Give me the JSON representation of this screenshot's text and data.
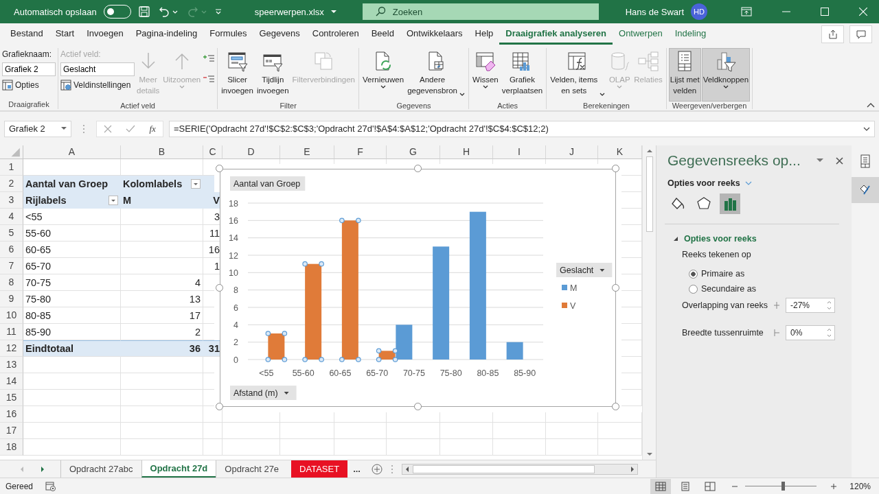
{
  "title_bar": {
    "autosave_label": "Automatisch opslaan",
    "autosave_on": false,
    "file_name": "speerwerpen.xlsx",
    "search_placeholder": "Zoeken",
    "user_name": "Hans de Swart",
    "user_initials": "HD"
  },
  "menu_tabs": [
    {
      "label": "Bestand",
      "selected": false,
      "kind": "normal"
    },
    {
      "label": "Start",
      "selected": false,
      "kind": "normal"
    },
    {
      "label": "Invoegen",
      "selected": false,
      "kind": "normal"
    },
    {
      "label": "Pagina-indeling",
      "selected": false,
      "kind": "normal"
    },
    {
      "label": "Formules",
      "selected": false,
      "kind": "normal"
    },
    {
      "label": "Gegevens",
      "selected": false,
      "kind": "normal"
    },
    {
      "label": "Controleren",
      "selected": false,
      "kind": "normal"
    },
    {
      "label": "Beeld",
      "selected": false,
      "kind": "normal"
    },
    {
      "label": "Ontwikkelaars",
      "selected": false,
      "kind": "normal"
    },
    {
      "label": "Help",
      "selected": false,
      "kind": "normal"
    },
    {
      "label": "Draaigrafiek analyseren",
      "selected": true,
      "kind": "contextual"
    },
    {
      "label": "Ontwerpen",
      "selected": false,
      "kind": "contextual"
    },
    {
      "label": "Indeling",
      "selected": false,
      "kind": "contextual"
    }
  ],
  "ribbon": {
    "groups": [
      {
        "label": "Draaigrafiek",
        "items": [
          {
            "kind": "caption",
            "text": "Grafieknaam:",
            "disabled": false
          },
          {
            "kind": "field",
            "value": "Grafiek 2"
          },
          {
            "kind": "small",
            "label": "Opties",
            "disabled": false
          }
        ]
      },
      {
        "label": "Actief veld",
        "items": [
          {
            "kind": "caption",
            "text": "Actief veld:",
            "disabled": true
          },
          {
            "kind": "field",
            "value": "Geslacht"
          },
          {
            "kind": "small",
            "label": "Veldinstellingen",
            "disabled": false
          },
          {
            "kind": "big",
            "label": "Meer\ndetails",
            "disabled": true,
            "dropdown": false,
            "pressed": false
          },
          {
            "kind": "big",
            "label": "Uitzoomen",
            "disabled": true,
            "dropdown": true,
            "pressed": false
          },
          {
            "kind": "expand",
            "disabled": false
          },
          {
            "kind": "collapse",
            "disabled": false
          }
        ]
      },
      {
        "label": "Filter",
        "items": [
          {
            "kind": "big",
            "label": "Slicer\ninvoegen",
            "disabled": false,
            "dropdown": false,
            "pressed": false
          },
          {
            "kind": "big",
            "label": "Tijdlijn\ninvoegen",
            "disabled": false,
            "dropdown": false,
            "pressed": false
          },
          {
            "kind": "big",
            "label": "Filterverbindingen",
            "disabled": true,
            "dropdown": false,
            "pressed": false
          }
        ]
      },
      {
        "label": "Gegevens",
        "items": [
          {
            "kind": "big",
            "label": "Vernieuwen",
            "disabled": false,
            "dropdown": true,
            "pressed": false
          },
          {
            "kind": "big",
            "label": "Andere\ngegevensbron",
            "disabled": false,
            "dropdown": true,
            "pressed": false
          }
        ]
      },
      {
        "label": "Acties",
        "items": [
          {
            "kind": "big",
            "label": "Wissen",
            "disabled": false,
            "dropdown": true,
            "pressed": false
          },
          {
            "kind": "big",
            "label": "Grafiek\nverplaatsen",
            "disabled": false,
            "dropdown": false,
            "pressed": false
          }
        ]
      },
      {
        "label": "Berekeningen",
        "items": [
          {
            "kind": "big",
            "label": "Velden, items\nen sets",
            "disabled": false,
            "dropdown": true,
            "pressed": false
          },
          {
            "kind": "big",
            "label": "OLAP",
            "disabled": true,
            "dropdown": true,
            "pressed": false
          },
          {
            "kind": "big",
            "label": "Relaties",
            "disabled": true,
            "dropdown": false,
            "pressed": false
          }
        ]
      },
      {
        "label": "Weergeven/verbergen",
        "items": [
          {
            "kind": "big",
            "label": "Lijst met\nvelden",
            "disabled": false,
            "dropdown": false,
            "pressed": true
          },
          {
            "kind": "big",
            "label": "Veldknoppen",
            "disabled": false,
            "dropdown": true,
            "pressed": true
          }
        ]
      }
    ]
  },
  "formula_bar": {
    "name_box": "Grafiek 2",
    "insert_function": "fx",
    "formula": "=SERIE('Opdracht 27d'!$C$2:$C$3;'Opdracht 27d'!$A$4:$A$12;'Opdracht 27d'!$C$4:$C$12;2)"
  },
  "sheet": {
    "columns": [
      "A",
      "B",
      "C",
      "D",
      "E",
      "F",
      "G",
      "H",
      "I",
      "J",
      "K"
    ],
    "rows": [
      {
        "number": "1",
        "kind": "plain"
      },
      {
        "number": "2",
        "kind": "header",
        "a": "Aantal van Groep",
        "b": "Kolomlabels",
        "b_filter": true
      },
      {
        "number": "3",
        "kind": "header",
        "a": "Rijlabels",
        "a_filter": true,
        "b": "M",
        "c": "V"
      },
      {
        "number": "4",
        "kind": "body",
        "a": "<55",
        "c": "3"
      },
      {
        "number": "5",
        "kind": "body",
        "a": "55-60",
        "c": "11"
      },
      {
        "number": "6",
        "kind": "body",
        "a": "60-65",
        "c": "16"
      },
      {
        "number": "7",
        "kind": "body",
        "a": "65-70",
        "c": "1"
      },
      {
        "number": "8",
        "kind": "body",
        "a": "70-75",
        "b": "4"
      },
      {
        "number": "9",
        "kind": "body",
        "a": "75-80",
        "b": "13"
      },
      {
        "number": "10",
        "kind": "body",
        "a": "80-85",
        "b": "17"
      },
      {
        "number": "11",
        "kind": "body",
        "a": "85-90",
        "b": "2"
      },
      {
        "number": "12",
        "kind": "total",
        "a": "Eindtotaal",
        "b": "36",
        "c": "31"
      },
      {
        "number": "13",
        "kind": "plain"
      },
      {
        "number": "14",
        "kind": "plain"
      },
      {
        "number": "15",
        "kind": "plain"
      },
      {
        "number": "16",
        "kind": "plain"
      },
      {
        "number": "17",
        "kind": "plain"
      },
      {
        "number": "18",
        "kind": "plain"
      }
    ]
  },
  "chart": {
    "value_field_button": {
      "label": "Aantal van Groep",
      "dropdown": false
    },
    "legend_field_button": {
      "label": "Geslacht",
      "dropdown": true
    },
    "axis_field_button": {
      "label": "Afstand (m)",
      "dropdown": true
    },
    "series_state": [
      {
        "selected": false
      },
      {
        "selected": true
      }
    ],
    "chart_data": {
      "type": "bar",
      "categories": [
        "<55",
        "55-60",
        "60-65",
        "65-70",
        "70-75",
        "75-80",
        "80-85",
        "85-90"
      ],
      "series": [
        {
          "name": "M",
          "color": "#5b9bd5",
          "values": [
            null,
            null,
            null,
            null,
            4,
            13,
            17,
            2
          ]
        },
        {
          "name": "V",
          "color": "#e07b39",
          "values": [
            3,
            11,
            16,
            1,
            null,
            null,
            null,
            null
          ]
        }
      ],
      "ylim": [
        0,
        18
      ],
      "yticks": [
        0,
        2,
        4,
        6,
        8,
        10,
        12,
        14,
        16,
        18
      ],
      "grid": true,
      "legend": "right"
    }
  },
  "format_pane": {
    "title": "Gegevensreeks op...",
    "options_menu": "Opties voor reeks",
    "format_tabs": [
      {
        "selected": false
      },
      {
        "selected": false
      },
      {
        "selected": true
      }
    ],
    "section": {
      "title": "Opties voor reeks",
      "expanded": true,
      "caption": "Reeks tekenen op",
      "radios": [
        {
          "label": "Primaire as",
          "selected": true
        },
        {
          "label": "Secundaire as",
          "selected": false
        }
      ],
      "spinners": [
        {
          "label": "Overlapping van reeks",
          "value": "-27%"
        },
        {
          "label": "Breedte tussenruimte",
          "value": "0%"
        }
      ]
    }
  },
  "side_strip": [
    {
      "selected": false
    },
    {
      "selected": true
    }
  ],
  "sheet_tabs": {
    "tabs": [
      {
        "label": "Opdracht 27abc",
        "selected": false
      },
      {
        "label": "Opdracht 27d",
        "selected": true
      },
      {
        "label": "Opdracht 27e",
        "selected": false
      },
      {
        "label": "DATASET",
        "selected": false,
        "color": "#e81123"
      }
    ],
    "more": "..."
  },
  "status_bar": {
    "status": "Gereed",
    "views": [
      {
        "selected": true
      },
      {
        "selected": false
      },
      {
        "selected": false
      }
    ],
    "zoom": {
      "level": 0.53,
      "reading": "120%"
    }
  }
}
